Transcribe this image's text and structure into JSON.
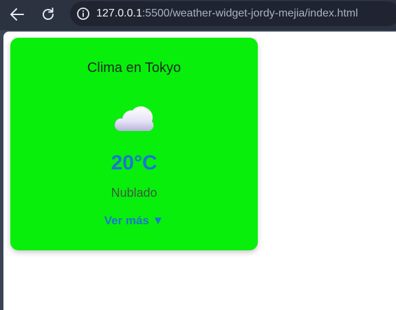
{
  "browser": {
    "url_host": "127.0.0.1",
    "url_rest": ":5500/weather-widget-jordy-mejia/index.html",
    "icons": {
      "back": "arrow-left-icon",
      "reload": "reload-icon",
      "info": "info-icon"
    }
  },
  "widget": {
    "title": "Clima en Tokyo",
    "icon": "cloud-icon",
    "temperature": "20°C",
    "condition": "Nublado",
    "more_label": "Ver más ▼",
    "colors": {
      "card_background": "#08ef0c",
      "accent": "#1b76d0"
    }
  }
}
